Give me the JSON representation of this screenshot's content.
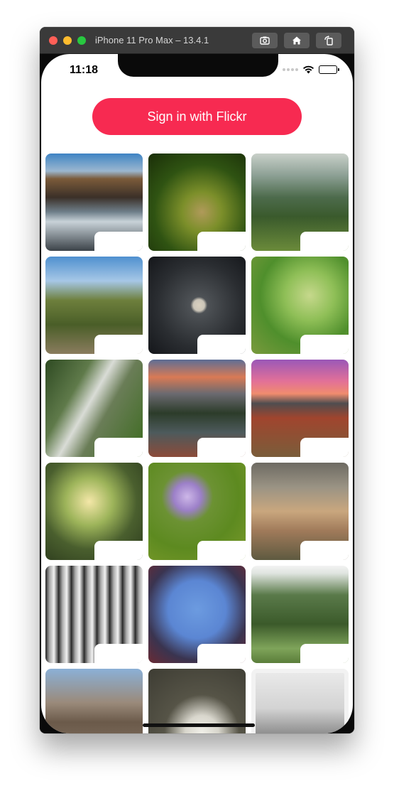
{
  "window": {
    "title": "iPhone 11 Pro Max – 13.4.1",
    "buttons": [
      {
        "name": "screenshot-icon"
      },
      {
        "name": "home-icon"
      },
      {
        "name": "rotate-icon"
      }
    ]
  },
  "status_bar": {
    "time": "11:18",
    "icons": [
      "signal-dots-icon",
      "wifi-icon",
      "battery-icon"
    ]
  },
  "app": {
    "signin_label": "Sign in with Flickr",
    "accent_color": "#f72a51"
  },
  "photos": [
    {
      "subject": "mountain beach with waves",
      "label": ""
    },
    {
      "subject": "grass seed head on green",
      "label": ""
    },
    {
      "subject": "green mountain valley",
      "label": ""
    },
    {
      "subject": "winding road through hills",
      "label": ""
    },
    {
      "subject": "moon behind clouds",
      "label": ""
    },
    {
      "subject": "dragonfly on leaf",
      "label": ""
    },
    {
      "subject": "waterfall cliffs",
      "label": ""
    },
    {
      "subject": "mountain lake at sunset",
      "label": ""
    },
    {
      "subject": "purple sunset over field",
      "label": ""
    },
    {
      "subject": "child with lantern in forest",
      "label": ""
    },
    {
      "subject": "purple flower with butterfly",
      "label": ""
    },
    {
      "subject": "woman portrait",
      "label": ""
    },
    {
      "subject": "black and white alley",
      "label": ""
    },
    {
      "subject": "dragon rooftop sculptures",
      "label": ""
    },
    {
      "subject": "birch trees",
      "label": ""
    },
    {
      "subject": "rocky mountain peaks",
      "label": ""
    },
    {
      "subject": "white jug and eggs still life",
      "label": ""
    },
    {
      "subject": "misty trees",
      "label": ""
    }
  ]
}
